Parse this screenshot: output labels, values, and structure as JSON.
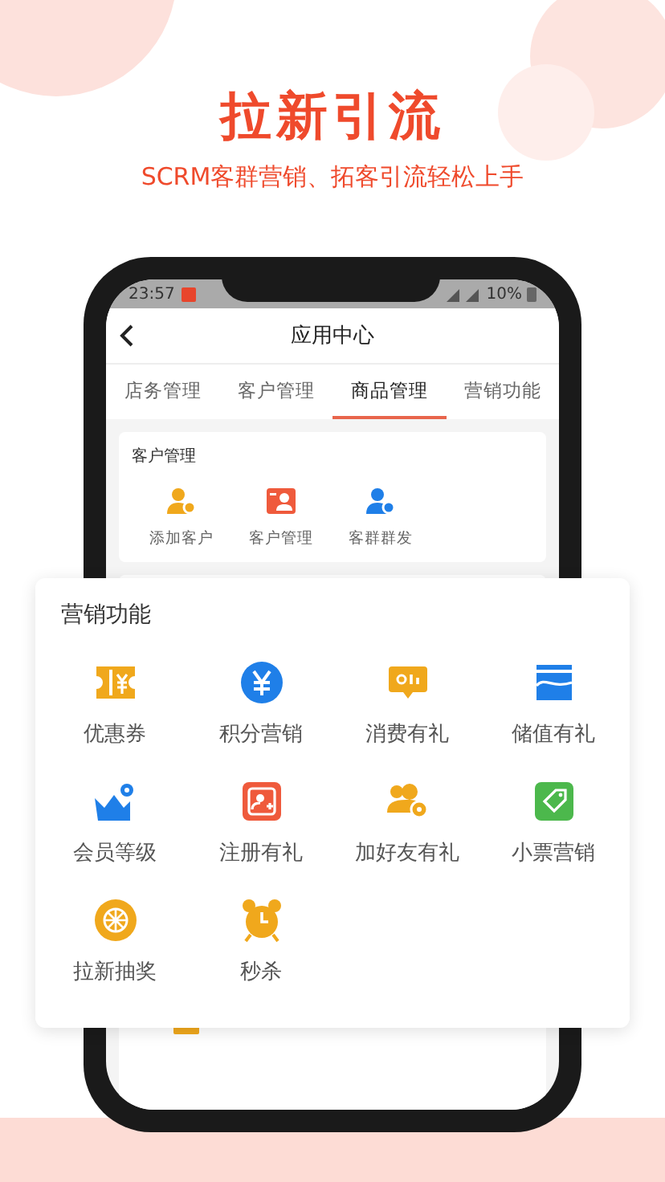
{
  "header": {
    "title": "拉新引流",
    "subtitle": "SCRM客群营销、拓客引流轻松上手"
  },
  "status_bar": {
    "time": "23:57",
    "battery": "10%"
  },
  "nav": {
    "title": "应用中心"
  },
  "tabs": [
    {
      "label": "店务管理",
      "selected": false
    },
    {
      "label": "客户管理",
      "selected": false
    },
    {
      "label": "商品管理",
      "selected": true
    },
    {
      "label": "营销功能",
      "selected": false
    }
  ],
  "customer_card": {
    "title": "客户管理",
    "items": [
      "添加客户",
      "客户管理",
      "客群群发"
    ]
  },
  "marketing_panel": {
    "title": "营销功能",
    "items": [
      "优惠券",
      "积分营销",
      "消费有礼",
      "储值有礼",
      "会员等级",
      "注册有礼",
      "加好友有礼",
      "小票营销",
      "拉新抽奖",
      "秒杀"
    ]
  }
}
